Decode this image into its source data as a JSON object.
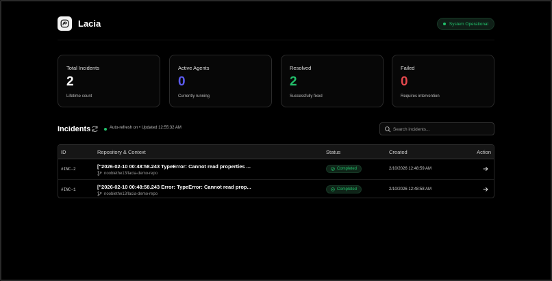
{
  "app": {
    "name": "Lacia",
    "status": "System Operational",
    "colors": {
      "accent_green": "#22c06b",
      "accent_blue": "#5b5bf0",
      "accent_red": "#e5484d",
      "background": "#000000"
    }
  },
  "stats": [
    {
      "label": "Total Incidents",
      "value": "2",
      "sub": "Lifetime count",
      "color": "#ffffff"
    },
    {
      "label": "Active Agents",
      "value": "0",
      "sub": "Currently running",
      "color": "#5b5bf0"
    },
    {
      "label": "Resolved",
      "value": "2",
      "sub": "Successfully fixed",
      "color": "#22c06b"
    },
    {
      "label": "Failed",
      "value": "0",
      "sub": "Requires intervention",
      "color": "#e5484d"
    }
  ],
  "incidents": {
    "title": "Incidents",
    "auto_refresh": "Auto-refresh on • Updated 12:55:32 AM",
    "search_placeholder": "Search incidents...",
    "columns": [
      "ID",
      "Repository & Context",
      "Status",
      "Created",
      "Action"
    ],
    "rows": [
      {
        "id": "#INC-2",
        "title": "[\"2026-02-10 00:48:58.243 TypeError: Cannot read properties ...",
        "repo": "noobiethe13/lacia-demo-repo",
        "status": "Completed",
        "created": "2/10/2026 12:48:59 AM"
      },
      {
        "id": "#INC-1",
        "title": "[\"2026-02-10 00:48:58.243 Error: TypeError: Cannot read prop...",
        "repo": "noobiethe13/lacia-demo-repo",
        "status": "Completed",
        "created": "2/10/2026 12:48:58 AM"
      }
    ]
  }
}
